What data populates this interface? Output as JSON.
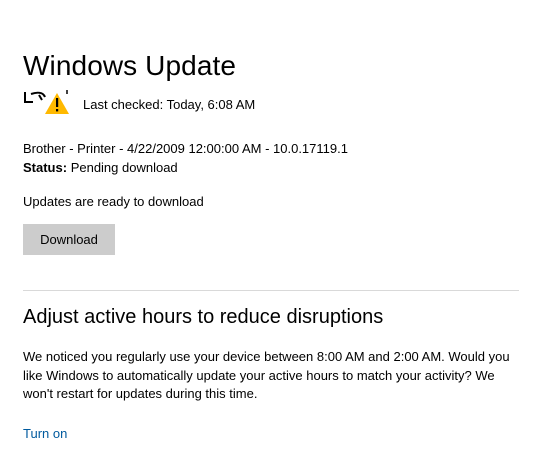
{
  "header": {
    "title": "Windows Update"
  },
  "status": {
    "last_checked": "Last checked: Today, 6:08 AM",
    "icon": "update-warning-icon"
  },
  "update": {
    "item": "Brother - Printer - 4/22/2009 12:00:00 AM - 10.0.17119.1",
    "status_label": "Status:",
    "status_value": "Pending download",
    "ready_text": "Updates are ready to download",
    "download_label": "Download"
  },
  "active_hours": {
    "heading": "Adjust active hours to reduce disruptions",
    "body": "We noticed you regularly use your device between 8:00 AM and 2:00 AM. Would you like Windows to automatically update your active hours to match your activity? We won't restart for updates during this time.",
    "link_label": "Turn on"
  },
  "colors": {
    "link": "#005a9e",
    "button_bg": "#cccccc",
    "warning": "#ffb900"
  }
}
